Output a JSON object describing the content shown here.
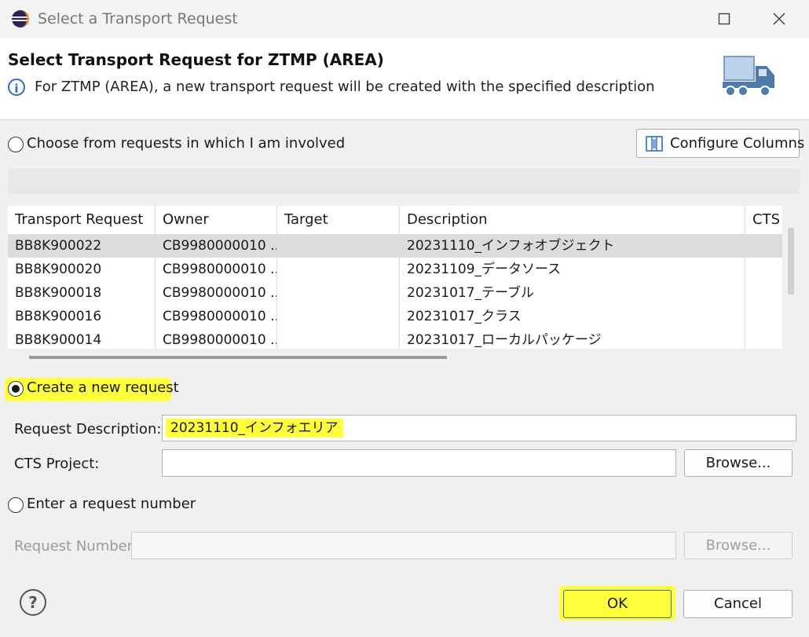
{
  "window": {
    "title": "Select a Transport Request"
  },
  "header": {
    "title": "Select Transport Request for ZTMP (AREA)",
    "message": "For ZTMP (AREA), a new transport request will be created with the specified description"
  },
  "option_choose": {
    "label": "Choose from requests in which I am involved",
    "selected": false
  },
  "configure_columns": {
    "label": "Configure Columns"
  },
  "table": {
    "columns": [
      "Transport Request",
      "Owner",
      "Target",
      "Description",
      "CTS I"
    ],
    "rows": [
      {
        "request": "BB8K900022",
        "owner": "CB9980000010 ...",
        "target": "",
        "description": "20231110_インフォオブジェクト",
        "cts": ""
      },
      {
        "request": "BB8K900020",
        "owner": "CB9980000010 ...",
        "target": "",
        "description": "20231109_データソース",
        "cts": ""
      },
      {
        "request": "BB8K900018",
        "owner": "CB9980000010 ...",
        "target": "",
        "description": "20231017_テーブル",
        "cts": ""
      },
      {
        "request": "BB8K900016",
        "owner": "CB9980000010 ...",
        "target": "",
        "description": "20231017_クラス",
        "cts": ""
      },
      {
        "request": "BB8K900014",
        "owner": "CB9980000010 ...",
        "target": "",
        "description": "20231017_ローカルパッケージ",
        "cts": ""
      }
    ]
  },
  "option_create": {
    "label": "Create a new request",
    "selected": true
  },
  "request_description": {
    "label": "Request Description: *",
    "value": "20231110_インフォエリア"
  },
  "cts_project": {
    "label": "CTS Project:",
    "value": "",
    "browse": "Browse..."
  },
  "option_enter": {
    "label": "Enter a request number",
    "selected": false
  },
  "request_number": {
    "label": "Request Number:",
    "value": "",
    "browse": "Browse..."
  },
  "footer": {
    "help": "?",
    "ok": "OK",
    "cancel": "Cancel"
  },
  "colors": {
    "highlight": "#ffff3b",
    "accent": "#2e6fb8"
  }
}
